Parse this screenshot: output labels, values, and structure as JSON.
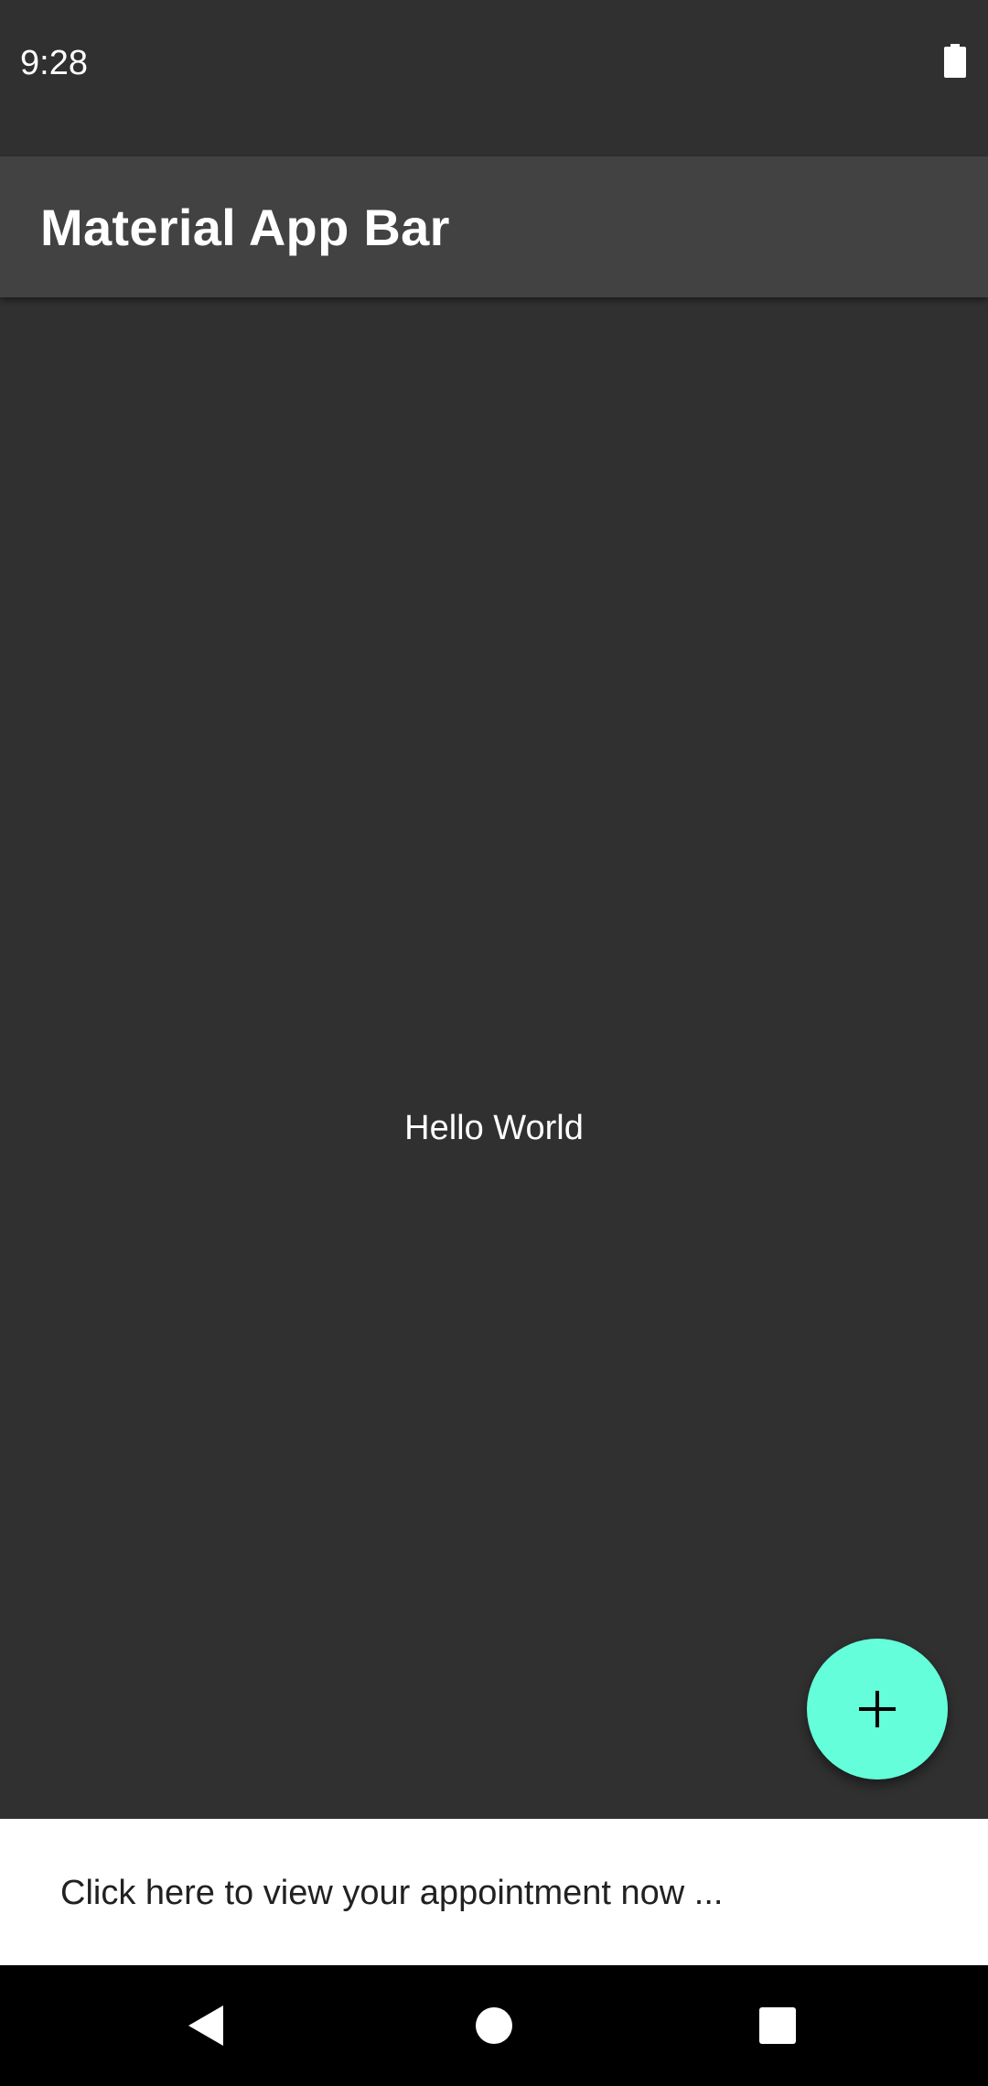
{
  "status_bar": {
    "time": "9:28",
    "battery_icon": "battery-full-icon"
  },
  "app_bar": {
    "title": "Material App Bar"
  },
  "content": {
    "message": "Hello World"
  },
  "fab": {
    "icon": "plus-icon",
    "color": "#64ffda"
  },
  "banner": {
    "text": "Click here to view your appointment now ..."
  },
  "nav_bar": {
    "back_icon": "back-triangle-icon",
    "home_icon": "home-circle-icon",
    "recents_icon": "recents-square-icon"
  },
  "colors": {
    "background": "#303030",
    "app_bar": "#424242",
    "accent": "#64ffda",
    "banner": "#ffffff",
    "nav_bar": "#000000"
  }
}
